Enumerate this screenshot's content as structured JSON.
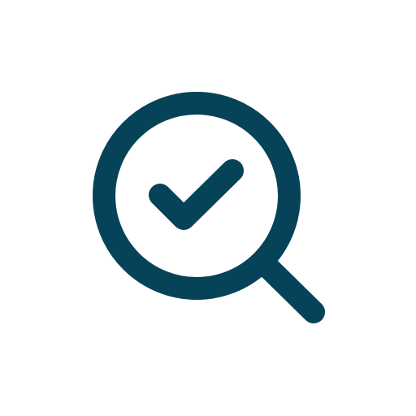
{
  "icon": {
    "name": "search-check-icon",
    "color": "#064358",
    "background": "#ffffff"
  }
}
